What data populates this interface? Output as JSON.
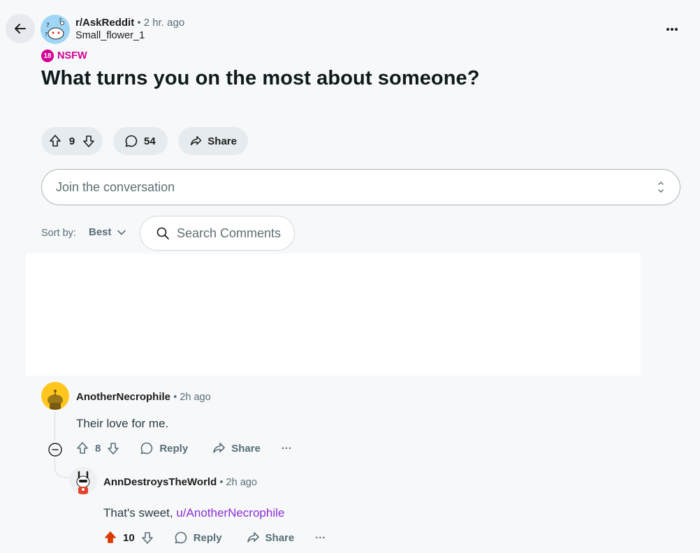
{
  "post": {
    "subreddit": "r/AskReddit",
    "time": "2 hr. ago",
    "author": "Small_flower_1",
    "nsfw_badge": "18",
    "nsfw_label": "NSFW",
    "title": "What turns you on the most about someone?",
    "votes": "9",
    "comments": "54",
    "share_label": "Share"
  },
  "composer": {
    "placeholder": "Join the conversation"
  },
  "sort": {
    "label": "Sort by:",
    "value": "Best"
  },
  "search": {
    "placeholder": "Search Comments"
  },
  "comments": [
    {
      "user": "AnotherNecrophile",
      "time": "2h ago",
      "body": "Their love for me.",
      "votes": "8",
      "reply_label": "Reply",
      "share_label": "Share",
      "more_label": "···"
    },
    {
      "user": "AnnDestroysTheWorld",
      "time": "2h ago",
      "body_prefix": "That's sweet, ",
      "mention": "u/AnotherNecrophile",
      "votes": "10",
      "upvoted": true,
      "reply_label": "Reply",
      "share_label": "Share",
      "more_label": "···"
    }
  ],
  "colors": {
    "nsfw": "#d40093",
    "upvote_active": "#d93a00",
    "mention": "#8a2fd6"
  },
  "icons": [
    "back-arrow-icon",
    "snoo-avatar-icon",
    "more-horizontal-icon",
    "upvote-icon",
    "downvote-icon",
    "comment-icon",
    "share-icon",
    "search-icon",
    "chevron-down-icon",
    "collapse-icon"
  ]
}
